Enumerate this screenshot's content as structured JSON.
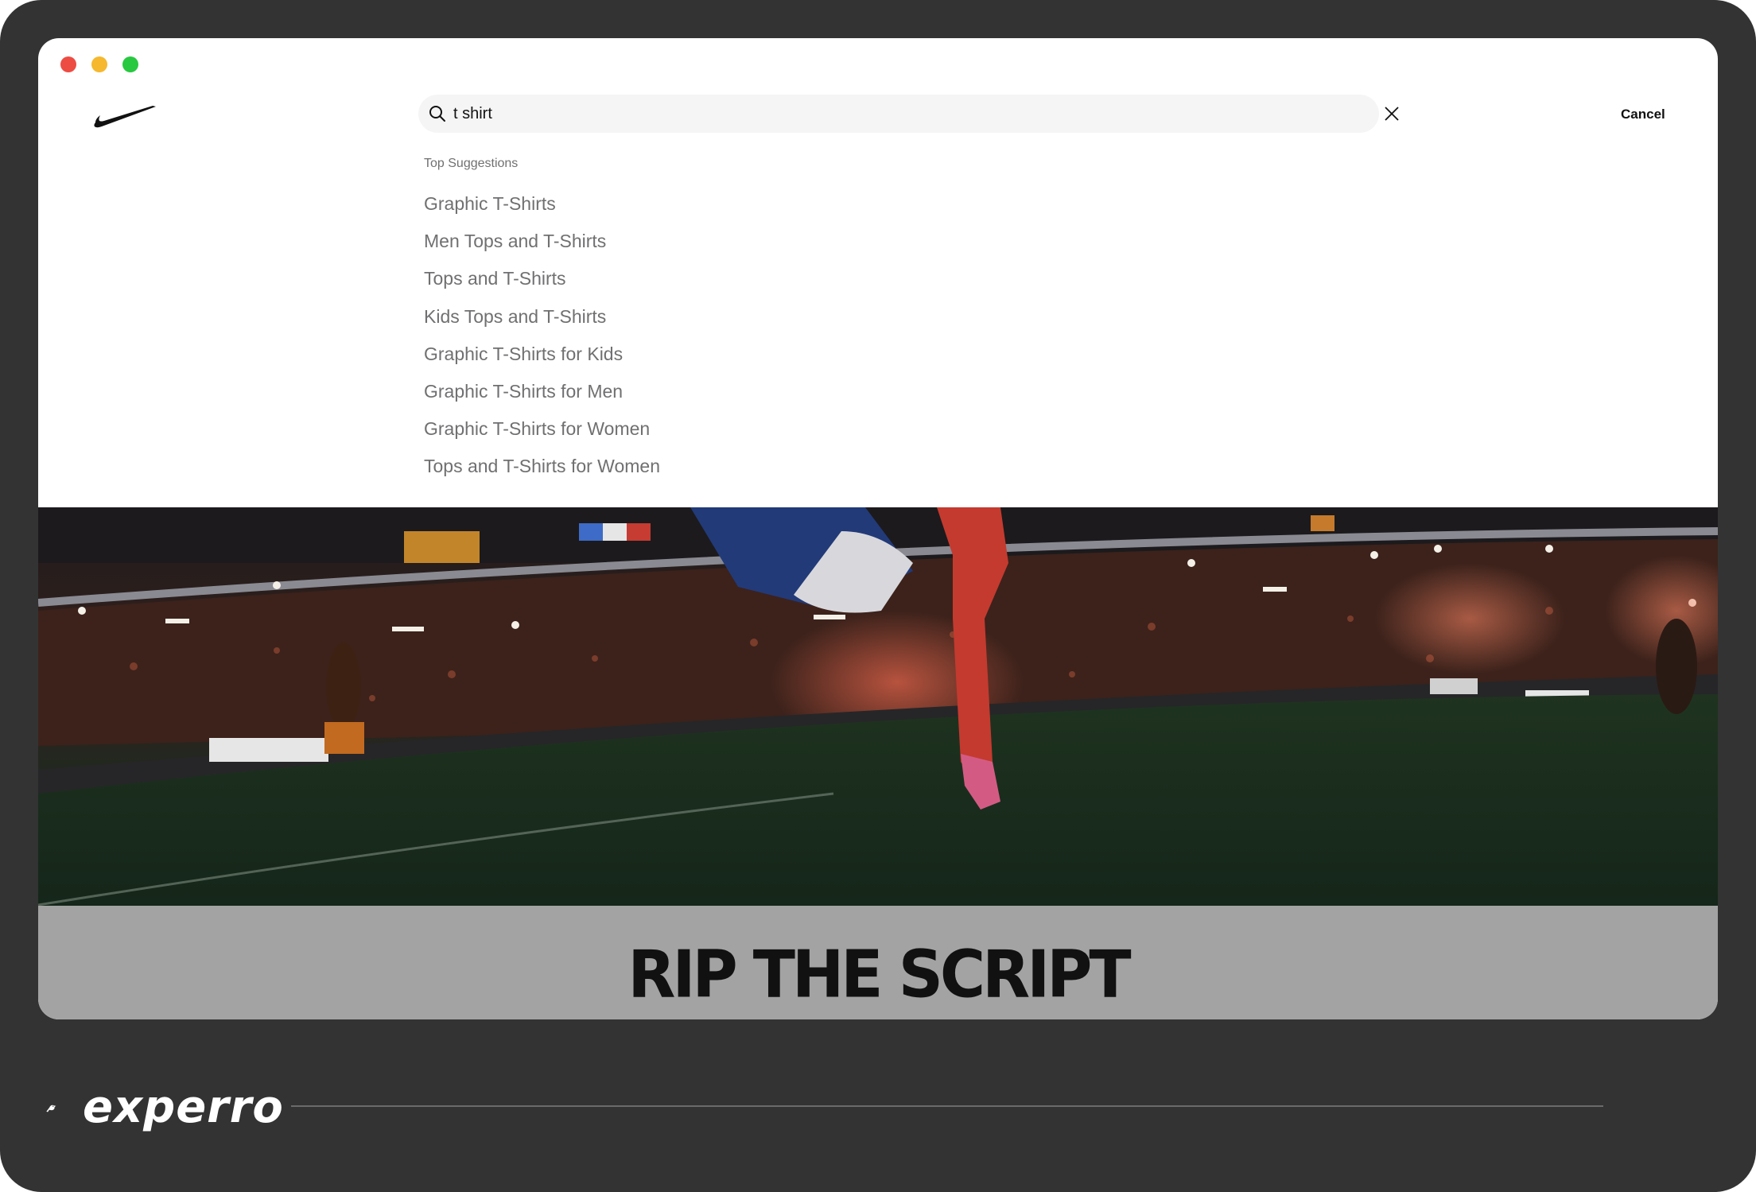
{
  "colors": {
    "frame_bg": "#333333",
    "window_bg": "#ffffff",
    "search_bg": "#f5f5f5",
    "suggestion_text": "#707072",
    "banner_bg": "#a3a3a3",
    "traffic_red": "#ed4c43",
    "traffic_yellow": "#f5b82e",
    "traffic_green": "#28c840"
  },
  "icons": {
    "logo": "nike-swoosh-icon",
    "search": "search-icon",
    "clear": "close-icon",
    "brand": "bird-icon"
  },
  "search": {
    "value": "t shirt",
    "cancel_label": "Cancel"
  },
  "suggestions": {
    "heading": "Top Suggestions",
    "items": [
      "Graphic T-Shirts",
      "Men Tops and T-Shirts",
      "Tops and T-Shirts",
      "Kids Tops and T-Shirts",
      "Graphic T-Shirts for Kids",
      "Graphic T-Shirts for Men",
      "Graphic T-Shirts for Women",
      "Tops and T-Shirts for Women"
    ]
  },
  "banner": {
    "title": "RIP THE SCRIPT"
  },
  "brand": {
    "name": "experro"
  }
}
